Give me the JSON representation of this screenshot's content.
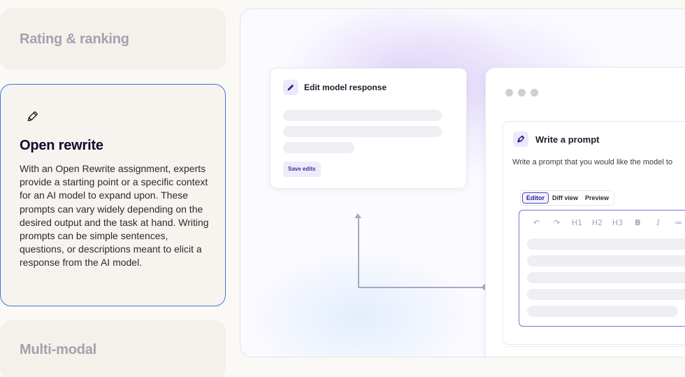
{
  "features": {
    "rating": {
      "label": "Rating & ranking"
    },
    "open_rewrite": {
      "icon": "pencil-icon",
      "title": "Open rewrite",
      "description": "With an Open Rewrite assignment, experts provide a starting point or a specific context for an AI model to expand upon. These prompts can vary widely depending on the desired output and the task at hand. Writing prompts can be simple sentences, questions, or descriptions meant to elicit a response from the AI model."
    },
    "multimodal": {
      "label": "Multi-modal"
    }
  },
  "preview": {
    "edit_card": {
      "title": "Edit model response",
      "icon": "pencil-icon",
      "save_label": "Save edits"
    },
    "prompt_card": {
      "title": "Write a prompt",
      "icon": "pen-nib-icon",
      "description": "Write a prompt that you would like the model to",
      "tabs": [
        "Editor",
        "Diff view",
        "Preview"
      ],
      "active_tab": "Editor",
      "toolbar": [
        "↶",
        "↷",
        "H1",
        "H2",
        "H3",
        "B",
        "I",
        "≔",
        "⋮"
      ]
    }
  },
  "colors": {
    "accent": "#3a78d8",
    "brand": "#4c45c4",
    "muted_label": "#a69fae"
  }
}
